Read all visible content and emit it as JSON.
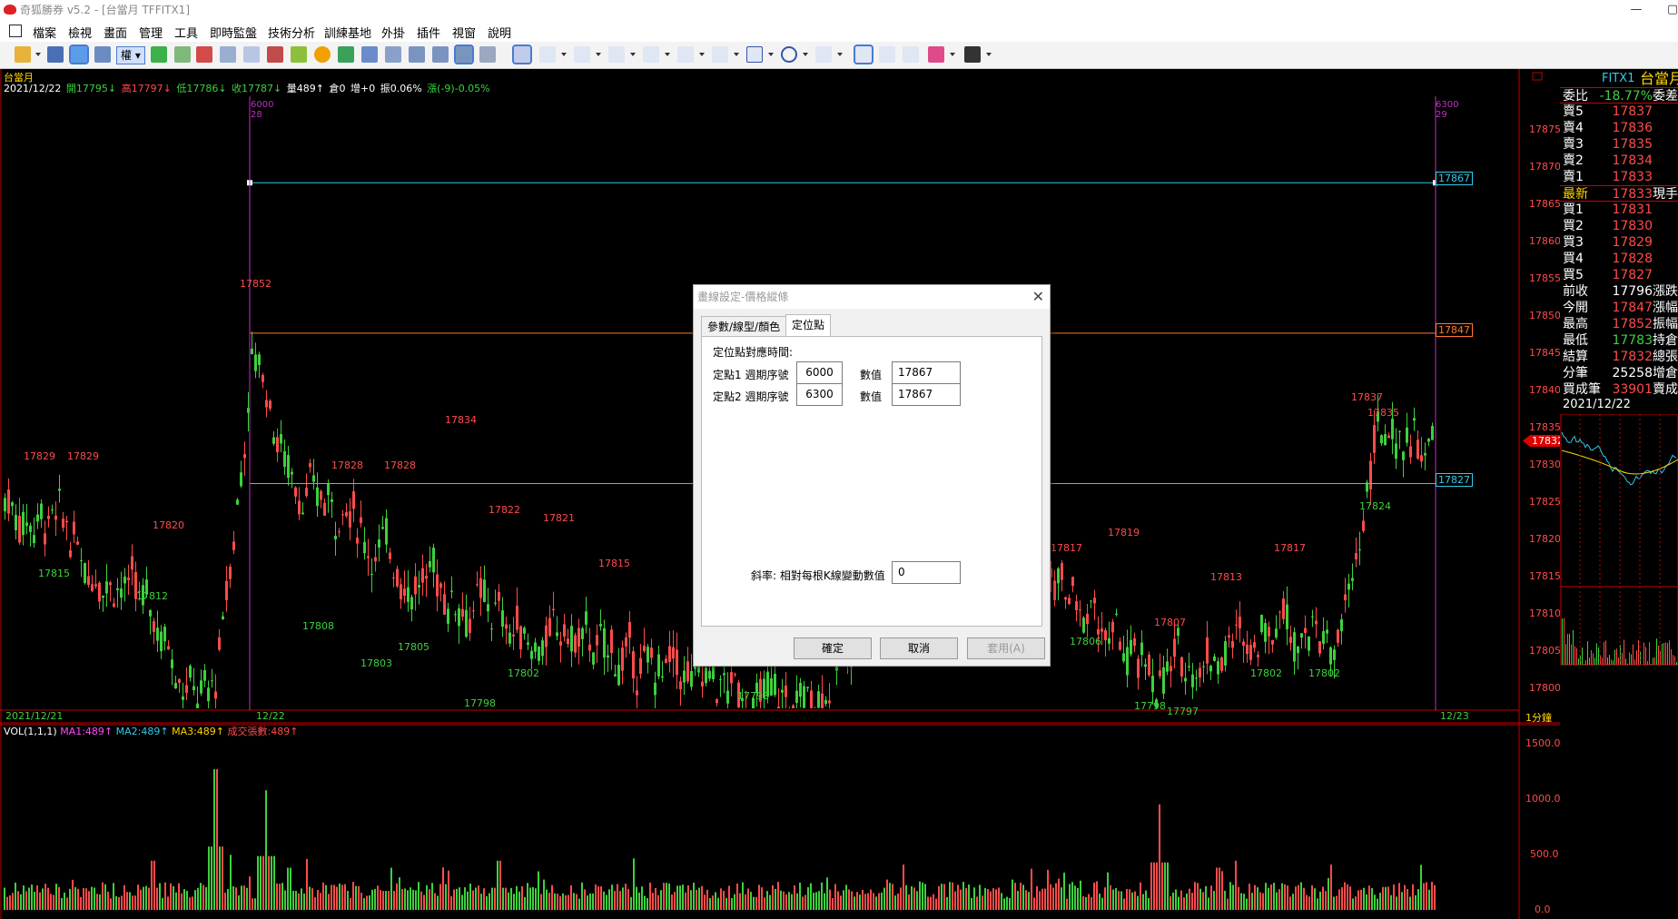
{
  "window": {
    "title": "奇狐勝券 v5.2 - [台當月 TFFITX1]"
  },
  "menu": [
    "檔案",
    "檢視",
    "畫面",
    "管理",
    "工具",
    "即時監盤",
    "技術分析",
    "訓練基地",
    "外掛",
    "插件",
    "視窗",
    "說明"
  ],
  "toolbar": {
    "weight_label": "權"
  },
  "chart": {
    "symbol": "台當月",
    "info": {
      "date": "2021/12/22",
      "open": "開17795↓",
      "high": "高17797↓",
      "low": "低17786↓",
      "close": "收17787↓",
      "vol": "量489↑",
      "pos": "倉0",
      "inc": "增+0",
      "amp": "振0.06%",
      "chg": "漲(-9)-0.05%"
    },
    "price_axis": [
      "17875",
      "17870",
      "17865",
      "17860",
      "17855",
      "17850",
      "17845",
      "17840",
      "17835",
      "17830",
      "17825",
      "17820",
      "17815",
      "17810",
      "17805",
      "17800"
    ],
    "current_price": "17832",
    "marker_left": {
      "top": "6000",
      "bottom": "28"
    },
    "marker_right": {
      "top": "6300",
      "bottom": "29"
    },
    "hlines": [
      "17867",
      "17847",
      "17827"
    ],
    "date_labels": [
      "2021/12/21",
      "12/22",
      "12/23"
    ],
    "period": "1分鐘",
    "price_labels": [
      "17829",
      "17829",
      "17815",
      "17820",
      "17812",
      "17852",
      "17808",
      "17828",
      "17803",
      "17828",
      "17805",
      "17834",
      "17798",
      "17822",
      "17802",
      "17821",
      "17815",
      "17798",
      "17817",
      "17806",
      "17819",
      "17798",
      "17807",
      "17797",
      "17813",
      "17802",
      "17817",
      "17802",
      "17837",
      "17835",
      "17824"
    ]
  },
  "chart_data": {
    "type": "line",
    "title": "台當月",
    "series": [
      {
        "name": "價格縱線",
        "values": [
          17867,
          17867
        ]
      }
    ],
    "x": [
      6000,
      6300
    ],
    "ylim": [
      17800,
      17875
    ]
  },
  "volume": {
    "legend": [
      "VOL(1,1,1)",
      "MA1:489↑",
      "MA2:489↑",
      "MA3:489↑",
      "成交張數:489↑"
    ],
    "axis": [
      "1500.0",
      "1000.0",
      "500.0",
      "0.0"
    ]
  },
  "quotes": {
    "header": "FITX1",
    "header_name": "台當月",
    "ratio_label": "委比",
    "ratio_value": "-18.77%",
    "ratio_extra": "委差",
    "asks": [
      {
        "label": "賣5",
        "value": "17837"
      },
      {
        "label": "賣4",
        "value": "17836"
      },
      {
        "label": "賣3",
        "value": "17835"
      },
      {
        "label": "賣2",
        "value": "17834"
      },
      {
        "label": "賣1",
        "value": "17833"
      }
    ],
    "last": {
      "label": "最新",
      "value": "17833",
      "extra": "現手"
    },
    "bids": [
      {
        "label": "買1",
        "value": "17831"
      },
      {
        "label": "買2",
        "value": "17830"
      },
      {
        "label": "買3",
        "value": "17829"
      },
      {
        "label": "買4",
        "value": "17828"
      },
      {
        "label": "買5",
        "value": "17827"
      }
    ],
    "stats": [
      {
        "label": "前收",
        "value": "17796",
        "extra": "漲跌",
        "color": "#ffffff"
      },
      {
        "label": "今開",
        "value": "17847",
        "extra": "漲幅",
        "color": "#ff4b4b"
      },
      {
        "label": "最高",
        "value": "17852",
        "extra": "振幅",
        "color": "#ff4b4b"
      },
      {
        "label": "最低",
        "value": "17783",
        "extra": "持倉",
        "color": "#3dd13d"
      },
      {
        "label": "結算",
        "value": "17832",
        "extra": "總張",
        "color": "#ff4b4b"
      },
      {
        "label": "分筆",
        "value": "25258",
        "extra": "增倉",
        "color": "#ffffff"
      },
      {
        "label": "買成筆",
        "value": "33901",
        "extra": "賣成",
        "color": "#ff4b4b"
      }
    ],
    "date": "2021/12/22"
  },
  "dialog": {
    "title": "畫線設定-價格縱條",
    "tabs": [
      "參數/線型/顏色",
      "定位點"
    ],
    "section": "定位點對應時間:",
    "p1_label": "定點1 週期序號",
    "p1_value": "6000",
    "p1_val_label": "數值",
    "p1_val": "17867",
    "p2_label": "定點2 週期序號",
    "p2_value": "6300",
    "p2_val_label": "數值",
    "p2_val": "17867",
    "slope_label": "斜率: 相對每根K線變動數值",
    "slope_value": "0",
    "ok": "確定",
    "cancel": "取消",
    "apply": "套用(A)"
  },
  "colors": {
    "up": "#ff4b4b",
    "down": "#3dd13d",
    "purple": "#c030c0",
    "cyan": "#35c8e8",
    "orange": "#ff7a30",
    "axis": "#c00000"
  }
}
